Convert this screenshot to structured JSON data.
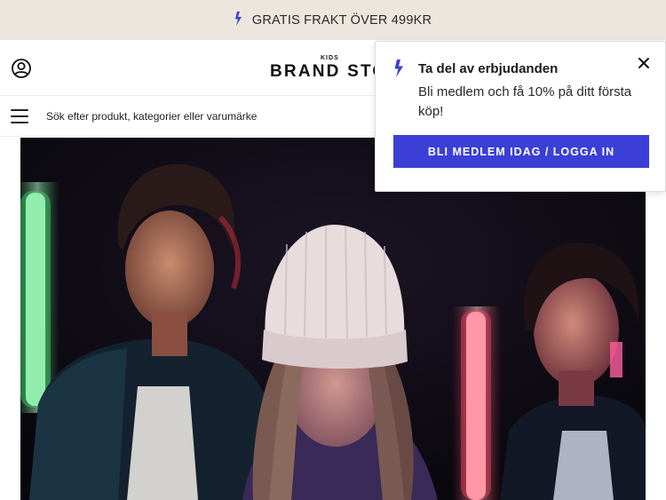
{
  "promo": {
    "icon": "lightning-bolt-icon",
    "text": "GRATIS FRAKT ÖVER 499KR"
  },
  "header": {
    "account_icon": "user-circle-icon",
    "logo_small": "KIDS",
    "logo_main": "BRAND STO"
  },
  "search": {
    "menu_icon": "hamburger-menu-icon",
    "placeholder": "Sök efter produkt, kategorier eller varumärke"
  },
  "popup": {
    "icon": "lightning-bolt-icon",
    "title": "Ta del av erbjudanden",
    "text": "Bli medlem och få 10% på ditt första köp!",
    "button_label": "BLI MEDLEM IDAG / LOGGA IN",
    "close_icon": "close-icon"
  },
  "colors": {
    "promo_background": "#ece6de",
    "accent": "#3b3fd6",
    "bolt": "#3b3fd6"
  }
}
